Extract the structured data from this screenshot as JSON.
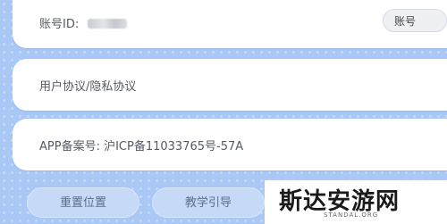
{
  "account": {
    "label": "账号ID:",
    "button_label": "账号"
  },
  "settings": {
    "agreement_label": "用户协议/隐私协议",
    "icp_label": "APP备案号: 沪ICP备11033765号-57A"
  },
  "actions": {
    "reset_label": "重置位置",
    "tutorial_label": "教学引导"
  },
  "watermark": {
    "title": "斯达安游网",
    "subtitle": "STANDAL.ORG"
  }
}
